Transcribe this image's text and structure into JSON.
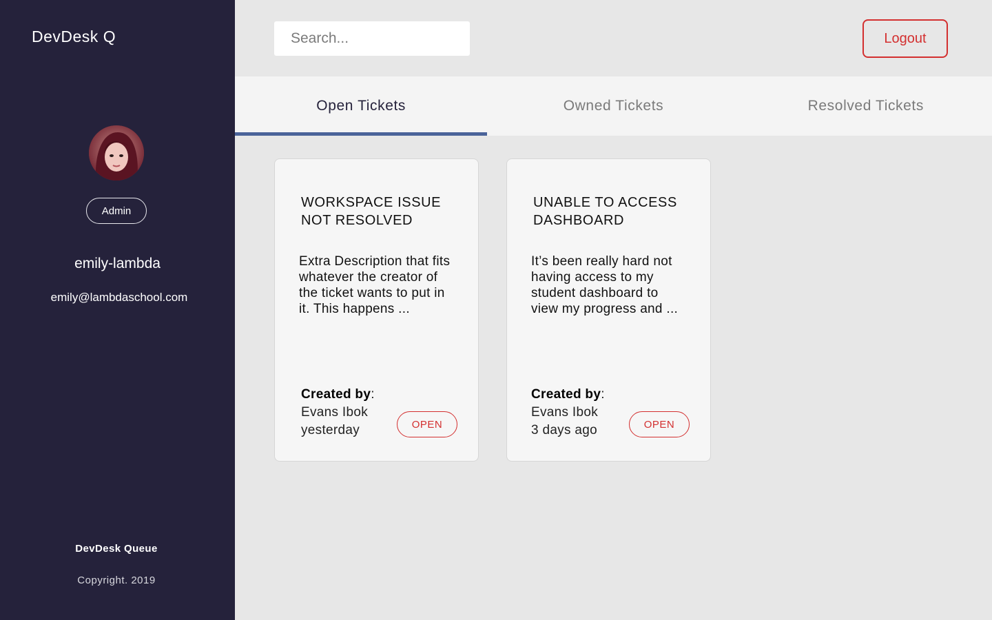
{
  "app": {
    "brand": "DevDesk Q",
    "footer_name": "DevDesk Queue",
    "footer_copyright": "Copyright. 2019"
  },
  "user": {
    "role": "Admin",
    "username": "emily-lambda",
    "email": "emily@lambdaschool.com",
    "avatar_icon": "user-avatar-photo"
  },
  "header": {
    "search_placeholder": "Search...",
    "logout_label": "Logout"
  },
  "tabs": [
    {
      "label": "Open Tickets",
      "active": true
    },
    {
      "label": "Owned Tickets",
      "active": false
    },
    {
      "label": "Resolved Tickets",
      "active": false
    }
  ],
  "tickets": [
    {
      "title": "WORKSPACE ISSUE NOT RESOLVED",
      "description": "Extra Description that fits whatever the creator of the ticket wants to put in it. This happens ...",
      "created_by_label": "Created by",
      "author": "Evans Ibok",
      "time": "yesterday",
      "status": "OPEN"
    },
    {
      "title": "UNABLE TO ACCESS DASHBOARD",
      "description": "It’s been really hard not having access to my student dashboard to view my progress and ...",
      "created_by_label": "Created by",
      "author": "Evans Ibok",
      "time": "3 days ago",
      "status": "OPEN"
    }
  ],
  "colors": {
    "sidebar_bg": "#25223b",
    "page_bg": "#e7e7e7",
    "accent_red": "#d32f2f",
    "tab_indicator": "#4a6399"
  }
}
